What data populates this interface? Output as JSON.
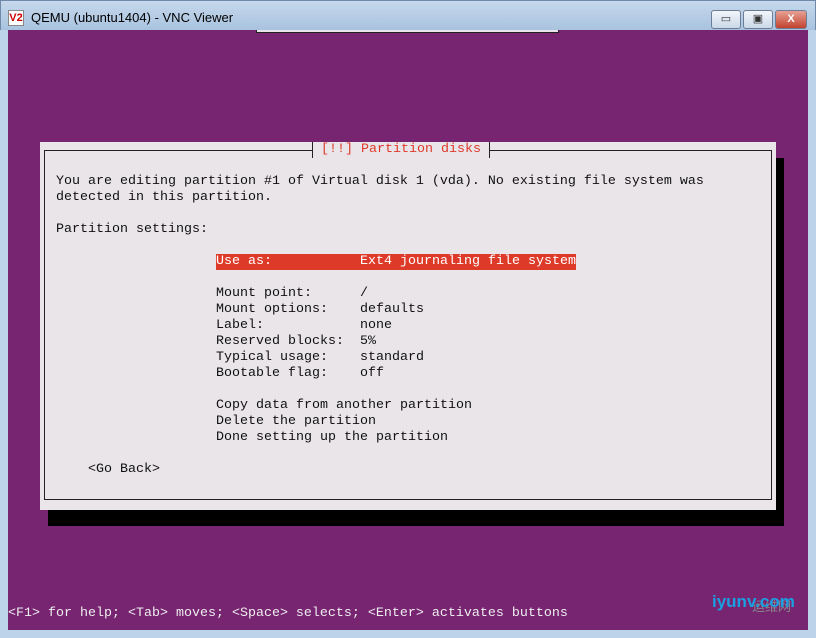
{
  "window": {
    "title": "QEMU (ubuntu1404) - VNC Viewer",
    "icon_text": "V2",
    "minimize": "▭",
    "maximize": "▣",
    "close": "X"
  },
  "dialog": {
    "title": "[!!] Partition disks",
    "intro_line1": "You are editing partition #1 of Virtual disk 1 (vda). No existing file system was",
    "intro_line2": "detected in this partition.",
    "section": "Partition settings:",
    "settings": [
      {
        "label": "Use as:",
        "value": "Ext4 journaling file system",
        "selected": true
      },
      {
        "label": "Mount point:",
        "value": "/"
      },
      {
        "label": "Mount options:",
        "value": "defaults"
      },
      {
        "label": "Label:",
        "value": "none"
      },
      {
        "label": "Reserved blocks:",
        "value": "5%"
      },
      {
        "label": "Typical usage:",
        "value": "standard"
      },
      {
        "label": "Bootable flag:",
        "value": "off"
      }
    ],
    "actions": [
      "Copy data from another partition",
      "Delete the partition",
      "Done setting up the partition"
    ],
    "go_back": "<Go Back>"
  },
  "status_bar": "<F1> for help; <Tab> moves; <Space> selects; <Enter> activates buttons",
  "watermark": {
    "text": "iyunv.com",
    "cn": "运维网"
  }
}
